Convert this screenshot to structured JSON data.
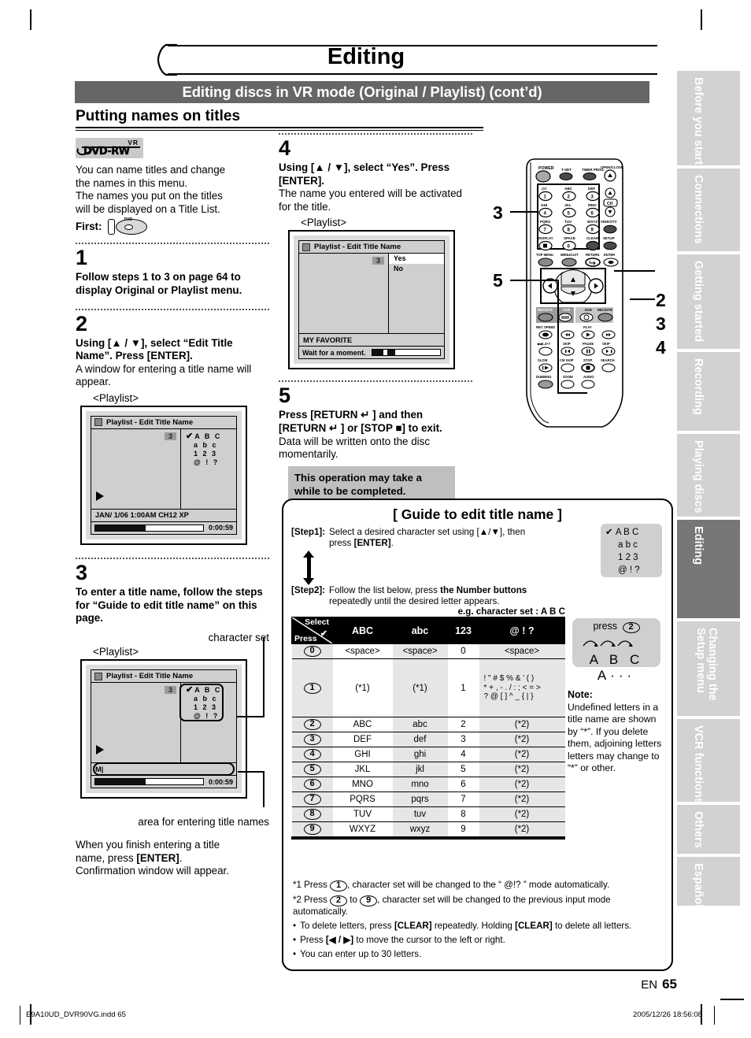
{
  "page": {
    "title": "Editing",
    "banner": "Editing discs in VR mode (Original / Playlist) (cont’d)",
    "section": "Putting names on titles",
    "page_label": "EN",
    "page_number": "65",
    "imprint_left": "E9A10UD_DVR90VG.indd   65",
    "imprint_right": "2005/12/26   18:56:08"
  },
  "disc_logo": {
    "vr": "VR",
    "name": "DVD-RW"
  },
  "intro": {
    "line1": "You can name titles and change",
    "line2": "the names in this menu.",
    "line3": "The names you put on the titles",
    "line4": "will be displayed on a Title List.",
    "first_label": "First:",
    "disc_icon_text": "DVD"
  },
  "steps": {
    "s1": {
      "num": "1",
      "bold": "Follow steps 1 to 3 on page 64 to display Original or Playlist menu."
    },
    "s2": {
      "num": "2",
      "bold": "Using [▲ / ▼], select “Edit Title Name”. Press [ENTER].",
      "normal": "A window for entering a title name will appear.",
      "caption": "<Playlist>"
    },
    "s3": {
      "num": "3",
      "bold": "To enter a title name, follow the steps for “Guide to edit title name” on this page.",
      "caption": "<Playlist>",
      "label_charset": "character set",
      "label_entry": "area for entering title names",
      "after1": "When you finish entering a title",
      "after2": "name, press ",
      "after2b": "[ENTER]",
      "after2c": ".",
      "after3": "Confirmation window will appear."
    },
    "s4": {
      "num": "4",
      "bold": "Using [▲ / ▼], select “Yes”. Press [ENTER].",
      "normal": "The name you entered will be activated for the title.",
      "caption": "<Playlist>"
    },
    "s5": {
      "num": "5",
      "bold": "Press [RETURN ↵ ] and then [RETURN ↵ ] or [STOP ■] to exit.",
      "normal": "Data will be written onto the disc momentarily.",
      "gray_note": "This operation may take a while to be completed."
    }
  },
  "osd1": {
    "title": "Playlist - Edit Title Name",
    "badge": "3",
    "charset_rows": [
      "A  B  C",
      "a  b  c",
      "1  2  3",
      "@  !   ?"
    ],
    "check": "✔",
    "info": "JAN/ 1/06 1:00AM CH12 XP",
    "time": "0:00:59"
  },
  "osd2": {
    "title": "Playlist - Edit Title Name",
    "badge": "3",
    "charset_rows": [
      "A  B  C",
      "a  b  c",
      "1  2  3",
      "@  !   ?"
    ],
    "check": "✔",
    "entry_text": "M|",
    "time": "0:00:59"
  },
  "osd3": {
    "title": "Playlist - Edit Title Name",
    "badge": "3",
    "option_yes": "Yes",
    "option_no": "No",
    "info": "MY FAVORITE",
    "status": "Wait for a moment."
  },
  "remote": {
    "callouts_left": [
      "3",
      "5"
    ],
    "callouts_right": [
      "2",
      "3",
      "4"
    ],
    "labels": {
      "power": "POWER",
      "tset": "T-SET",
      "timer_prog": "TIMER PROG.",
      "open_close": "OPEN/CLOSE",
      "k1": ".@/:",
      "k2": "ABC",
      "k3": "DEF",
      "k4": "GHI",
      "k5": "JKL",
      "k6": "MNO",
      "k7": "PQRS",
      "k8": "TUV",
      "k9": "WXYZ",
      "display": "DISPLAY",
      "space": "SPACE",
      "clear": "CLEAR",
      "ch": "CH",
      "video_tv": "VIDEO/TV",
      "setup": "SETUP",
      "top_menu": "TOP MENU",
      "menu_list": "MENU/LIST",
      "return": "RETURN",
      "enter": "ENTER",
      "rec_otr_l": "REC/OTR",
      "vcr": "VCR",
      "dvd": "DVD",
      "rec_otr_r": "REC/OTR",
      "rec_speed": "REC SPEED",
      "play": "PLAY",
      "rev": "◄◄1.3××",
      "skip_l": "SKIP",
      "pause": "PAUSE",
      "skip_r": "SKIP",
      "slow": "SLOW",
      "cm_skip": "CM SKIP",
      "stop": "STOP",
      "search": "SEARCH",
      "dubbing": "DUBBING",
      "zoom": "ZOOM",
      "audio": "AUDIO"
    }
  },
  "guide": {
    "heading": "[ Guide to edit title name ]",
    "step1_label": "[Step1]:",
    "step1_text_a": "Select a desired character set using [▲/▼], then press ",
    "step1_text_b": "[ENTER]",
    "step1_text_c": ".",
    "step2_label": "[Step2]:",
    "step2_text_a": "Follow the list below, press ",
    "step2_text_b": "the Number buttons",
    "step2_text_c": " repeatedly until the desired letter appears.",
    "eg": "e.g. character set :  A B C",
    "charset_chip": {
      "check": "✔",
      "rows": [
        "A B C",
        "a b c",
        "1 2 3",
        "@ ! ?"
      ]
    },
    "press_chip": {
      "label": "press",
      "key": "2",
      "sequence": "A B C A···"
    },
    "note": {
      "title": "Note:",
      "text": "Undefined letters in a title name are shown by “*”.  If you delete them, adjoining letters letters may change to “*” or other."
    },
    "table": {
      "corner_select": "Select",
      "corner_press": "Press",
      "corner_check": "✔",
      "headers": [
        "ABC",
        "abc",
        "123",
        "@ ! ?"
      ],
      "rows": [
        {
          "key": "0",
          "cells": [
            "<space>",
            "<space>",
            "0",
            "<space>"
          ]
        },
        {
          "key": "1",
          "cells": [
            "(*1)",
            "(*1)",
            "1",
            "! \" # $ % & ’ ( )\n* + , - . / : ; < = >\n? @ [ ] ^ _ { | }"
          ]
        },
        {
          "key": "2",
          "cells": [
            "ABC",
            "abc",
            "2",
            "(*2)"
          ]
        },
        {
          "key": "3",
          "cells": [
            "DEF",
            "def",
            "3",
            "(*2)"
          ]
        },
        {
          "key": "4",
          "cells": [
            "GHI",
            "ghi",
            "4",
            "(*2)"
          ]
        },
        {
          "key": "5",
          "cells": [
            "JKL",
            "jkl",
            "5",
            "(*2)"
          ]
        },
        {
          "key": "6",
          "cells": [
            "MNO",
            "mno",
            "6",
            "(*2)"
          ]
        },
        {
          "key": "7",
          "cells": [
            "PQRS",
            "pqrs",
            "7",
            "(*2)"
          ]
        },
        {
          "key": "8",
          "cells": [
            "TUV",
            "tuv",
            "8",
            "(*2)"
          ]
        },
        {
          "key": "9",
          "cells": [
            "WXYZ",
            "wxyz",
            "9",
            "(*2)"
          ]
        }
      ]
    },
    "footnotes": {
      "f1_a": "*1 Press ",
      "f1_key": "1",
      "f1_b": ", character set will be changed to the “ @!? ” mode automatically.",
      "f2_a": "*2 Press ",
      "f2_key1": "2",
      "f2_mid": " to ",
      "f2_key2": "9",
      "f2_b": ", character set will be changed to the previous input mode automatically.",
      "b1_a": "To delete letters, press ",
      "b1_k1": "[CLEAR]",
      "b1_mid": " repeatedly. Holding ",
      "b1_k2": "[CLEAR]",
      "b1_b": " to delete all letters.",
      "b2_a": "Press ",
      "b2_k": "[◀ / ▶]",
      "b2_b": " to move the cursor to the left or right.",
      "b3": "You can enter up to 30 letters."
    }
  },
  "tabs": [
    {
      "label": "Before you start",
      "active": false
    },
    {
      "label": "Connections",
      "active": false
    },
    {
      "label": "Getting started",
      "active": false
    },
    {
      "label": "Recording",
      "active": false
    },
    {
      "label": "Playing discs",
      "active": false
    },
    {
      "label": "Editing",
      "active": true
    },
    {
      "label": "Changing the Setup menu",
      "active": false
    },
    {
      "label": "VCR functions",
      "active": false
    },
    {
      "label": "Others",
      "active": false
    },
    {
      "label": "Español",
      "active": false
    }
  ]
}
